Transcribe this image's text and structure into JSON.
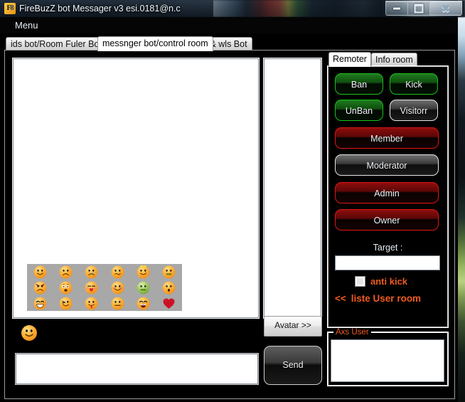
{
  "window": {
    "title": "FireBuzZ bot  Messager v3 esi.0181@n.c",
    "icon": "app-icon",
    "minimize_label": "–",
    "maximize_label": "□",
    "close_label": "✕"
  },
  "menubar": {
    "menu_label": "Menu"
  },
  "main_tabs": [
    {
      "label": "ids bot/Room Fuler Bot",
      "selected": false
    },
    {
      "label": "messnger bot/control room",
      "selected": true
    },
    {
      "label": "jok & wls Bot",
      "selected": false
    }
  ],
  "chat": {
    "output_value": "",
    "input_value": "",
    "input_placeholder": ""
  },
  "user_list": {
    "items": []
  },
  "emoji_palette": {
    "rows": [
      [
        "smile",
        "sad",
        "cry",
        "confused",
        "angel",
        "sick"
      ],
      [
        "angry",
        "shocked",
        "kiss",
        "blush",
        "sick-green",
        "surprised"
      ],
      [
        "laugh",
        "wink",
        "tongue",
        "neutral",
        "scream",
        "heart"
      ]
    ]
  },
  "smiley_button": {
    "icon": "smiley-icon"
  },
  "buttons": {
    "avatar_label": "Avatar >>",
    "send_label": "Send"
  },
  "right_tabs": [
    {
      "label": "Remoter",
      "selected": true
    },
    {
      "label": "Info room",
      "selected": false
    }
  ],
  "remoter": {
    "ban_label": "Ban",
    "kick_label": "Kick",
    "unban_label": "UnBan",
    "visitor_label": "Visitorr",
    "member_label": "Member",
    "moderator_label": "Moderator",
    "admin_label": "Admin",
    "owner_label": "Owner",
    "target_label": "Target :",
    "target_value": "",
    "anti_kick_label": "anti kick",
    "anti_kick_checked": false,
    "liste_arrows": "<<",
    "liste_label": "liste User room"
  },
  "axs_user": {
    "group_label": "Axs User",
    "items": []
  },
  "colors": {
    "accent_orange": "#ef5b22",
    "green_border": "#19c219",
    "red_border": "#e21414",
    "silver_border": "#e6e6e6",
    "panel_bg": "#000000"
  }
}
